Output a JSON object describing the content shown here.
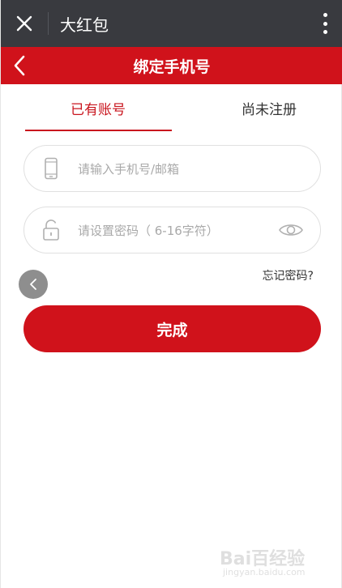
{
  "appbar": {
    "title": "大红包",
    "close_icon": "close-icon",
    "more_icon": "more-vertical-icon"
  },
  "header": {
    "title": "绑定手机号",
    "back_icon": "chevron-left-icon"
  },
  "tabs": [
    {
      "label": "已有账号",
      "active": true
    },
    {
      "label": "尚未注册",
      "active": false
    }
  ],
  "form": {
    "phone_placeholder": "请输入手机号/邮箱",
    "password_placeholder": "请设置密码（ 6-16字符）",
    "forgot_label": "忘记密码?",
    "submit_label": "完成"
  },
  "watermark": {
    "brand": "Bai百经验",
    "url": "jingyan.baidu.com"
  },
  "colors": {
    "appbar": "#393a3f",
    "accent_red": "#d0121b",
    "tab_active": "#c9151e",
    "placeholder": "#a9a9a9"
  }
}
